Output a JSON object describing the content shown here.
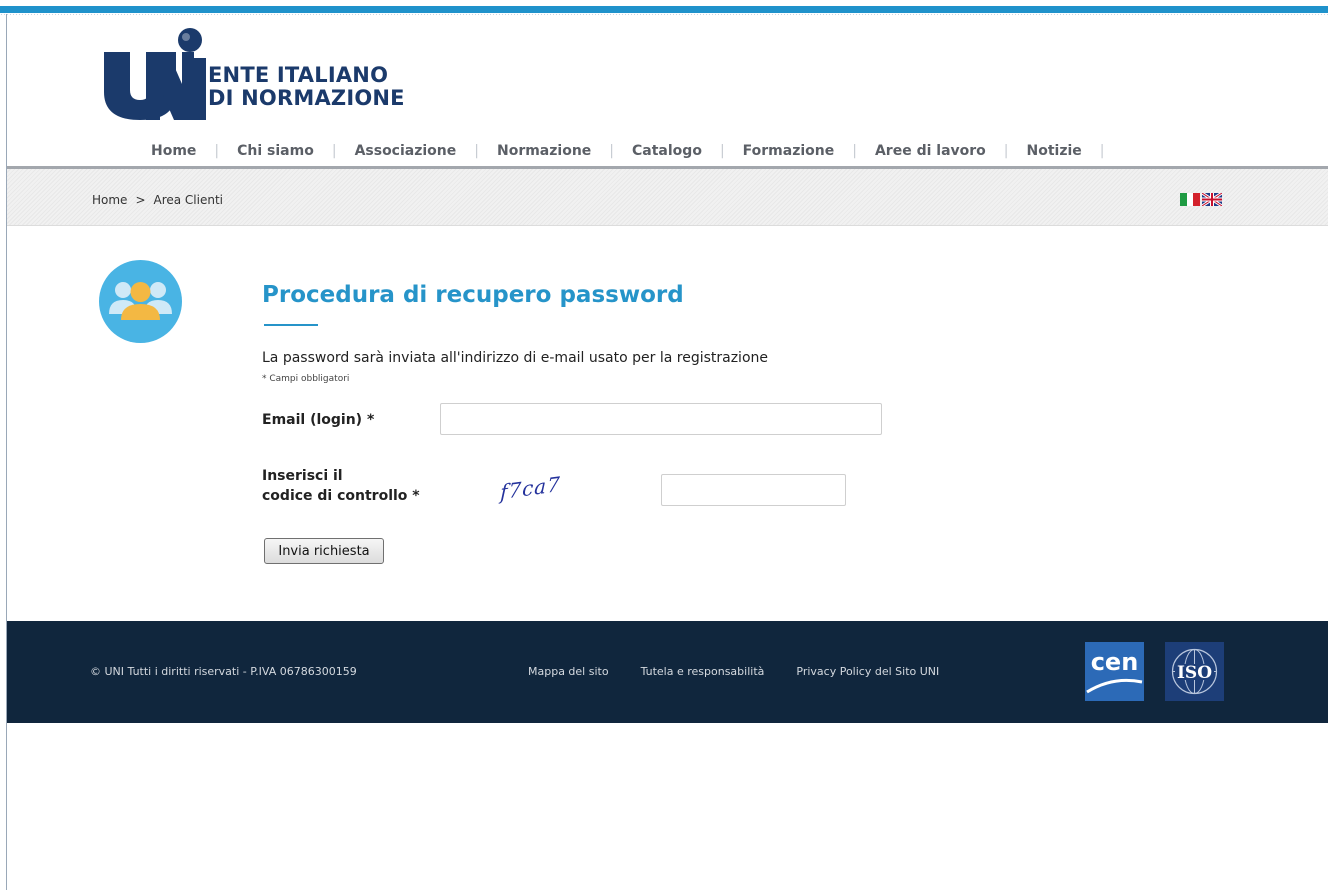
{
  "logo": {
    "mark": "UNI",
    "line1": "ENTE ITALIANO",
    "line2": "DI NORMAZIONE"
  },
  "nav": {
    "items": [
      {
        "label": "Home"
      },
      {
        "label": "Chi siamo"
      },
      {
        "label": "Associazione"
      },
      {
        "label": "Normazione"
      },
      {
        "label": "Catalogo"
      },
      {
        "label": "Formazione"
      },
      {
        "label": "Aree di lavoro"
      },
      {
        "label": "Notizie"
      }
    ],
    "separator": "|"
  },
  "breadcrumb": {
    "home": "Home",
    "separator": ">",
    "current": "Area Clienti"
  },
  "languages": [
    {
      "icon": "italy-flag-icon"
    },
    {
      "icon": "uk-flag-icon"
    }
  ],
  "form": {
    "title": "Procedura di recupero password",
    "intro": "La password sarà inviata all'indirizzo di e-mail usato per la registrazione",
    "required_note": "* Campi obbligatori",
    "email_label": "Email (login) *",
    "email_value": "",
    "code_label_line1": "Inserisci il",
    "code_label_line2": "codice di controllo *",
    "captcha_text": "f7ca7",
    "code_value": "",
    "submit_label": "Invia richiesta"
  },
  "footer": {
    "copyright": "© UNI Tutti i diritti riservati - P.IVA 06786300159",
    "links": [
      {
        "label": "Mappa del sito"
      },
      {
        "label": "Tutela e responsabilità"
      },
      {
        "label": "Privacy Policy del Sito UNI"
      }
    ],
    "cen_logo_text": "cen",
    "iso_logo_text": "ISO"
  },
  "colors": {
    "accent": "#1f92cb",
    "title": "#2694c9",
    "footer_bg": "#10263d",
    "logo_navy": "#1b3a6b"
  }
}
